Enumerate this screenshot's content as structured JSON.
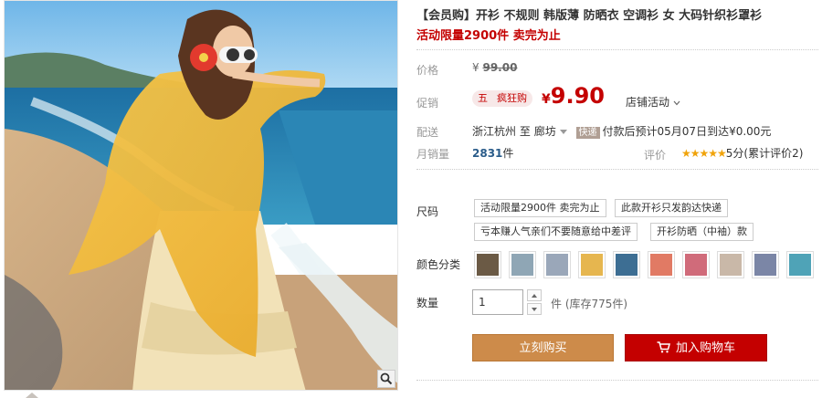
{
  "product": {
    "title": "【会员购】开衫 不规则 韩版薄 防晒衣 空调衫 女 大码针织衫罩衫",
    "subtitle": "活动限量2900件 卖完为止"
  },
  "price": {
    "label": "价格",
    "currency": "¥",
    "original": "99.00"
  },
  "promo": {
    "label": "促销",
    "tag_a": "五",
    "tag_b": "疯狂购",
    "currency": "¥",
    "price": "9.90",
    "store_promo": "店铺活动"
  },
  "shipping": {
    "label": "配送",
    "from": "浙江杭州",
    "to_word": "至",
    "dest": "廊坊",
    "badge": "快递",
    "note": "付款后预计05月07日到达¥0.00元"
  },
  "sales": {
    "label": "月销量",
    "count": "2831",
    "unit": "件",
    "rating_label": "评价",
    "stars": "★★★★★",
    "rating_text": "5分(累计评价2)"
  },
  "size": {
    "label": "尺码",
    "options": [
      "活动限量2900件 卖完为止",
      "此款开衫只发韵达快递",
      "亏本赚人气亲们不要随意给中差评",
      "开衫防晒（中袖）款"
    ]
  },
  "colors": {
    "label": "颜色分类",
    "swatches": [
      "#6b5a45",
      "#8fa6b5",
      "#9aa7b9",
      "#e6b64f",
      "#3d6e93",
      "#e17a64",
      "#d06b7a",
      "#c9b8a8",
      "#7b86a6",
      "#4fa3b7"
    ]
  },
  "quantity": {
    "label": "数量",
    "value": "1",
    "unit_stock": "件 (库存775件)"
  },
  "actions": {
    "buy_now": "立刻购买",
    "add_cart": "加入购物车"
  },
  "accent_colors": {
    "price_red": "#c40000",
    "buy_orange": "#cd8b4a",
    "star_gold": "#f0a30a"
  }
}
